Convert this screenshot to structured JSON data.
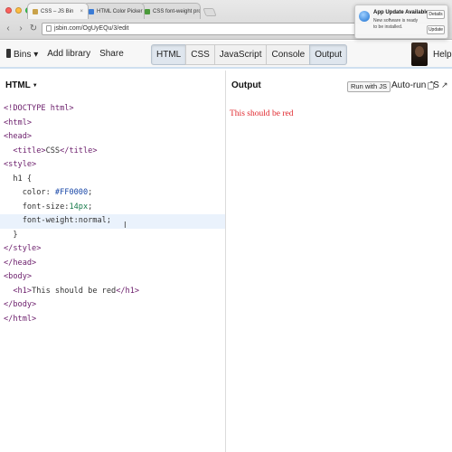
{
  "browser": {
    "tabs": [
      {
        "title": "CSS – JS Bin",
        "favicon_color": "#c9a24a",
        "active": true
      },
      {
        "title": "HTML Color Picker",
        "favicon_color": "#3a7bd5",
        "active": false
      },
      {
        "title": "CSS font-weight property",
        "favicon_color": "#4a9a3a",
        "active": false
      }
    ],
    "url": "jsbin.com/OgUyEQu/3/edit",
    "close_glyph": "×",
    "back_glyph": "‹",
    "forward_glyph": "›",
    "reload_glyph": "↻",
    "menu_glyph": "≡"
  },
  "notification": {
    "title": "App Update Available",
    "body": "New software is ready to be installed.",
    "details_label": "Details",
    "update_label": "Update"
  },
  "toolbar": {
    "bins_label": "Bins ▾",
    "add_library_label": "Add library",
    "share_label": "Share",
    "panels": [
      "HTML",
      "CSS",
      "JavaScript",
      "Console",
      "Output"
    ],
    "help_label": "Help"
  },
  "html_panel": {
    "label": "HTML",
    "code_lines": [
      "<!DOCTYPE html>",
      "<html>",
      "<head>",
      "  <title>CSS</title>",
      "<style>",
      "  h1 {",
      "    color: #FF0000;",
      "    font-size:14px;",
      "    font-weight:normal;",
      "  }",
      "</style>",
      "</head>",
      "<body>",
      "  <h1>This should be red</h1>",
      "</body>",
      "</html>"
    ],
    "current_line_index": 8
  },
  "output_panel": {
    "title": "Output",
    "run_label": "Run with JS",
    "autorun_label": "Auto-run JS",
    "expand_glyph": "↗",
    "rendered_text": "This should be red",
    "rendered_color": "#e0282e"
  }
}
